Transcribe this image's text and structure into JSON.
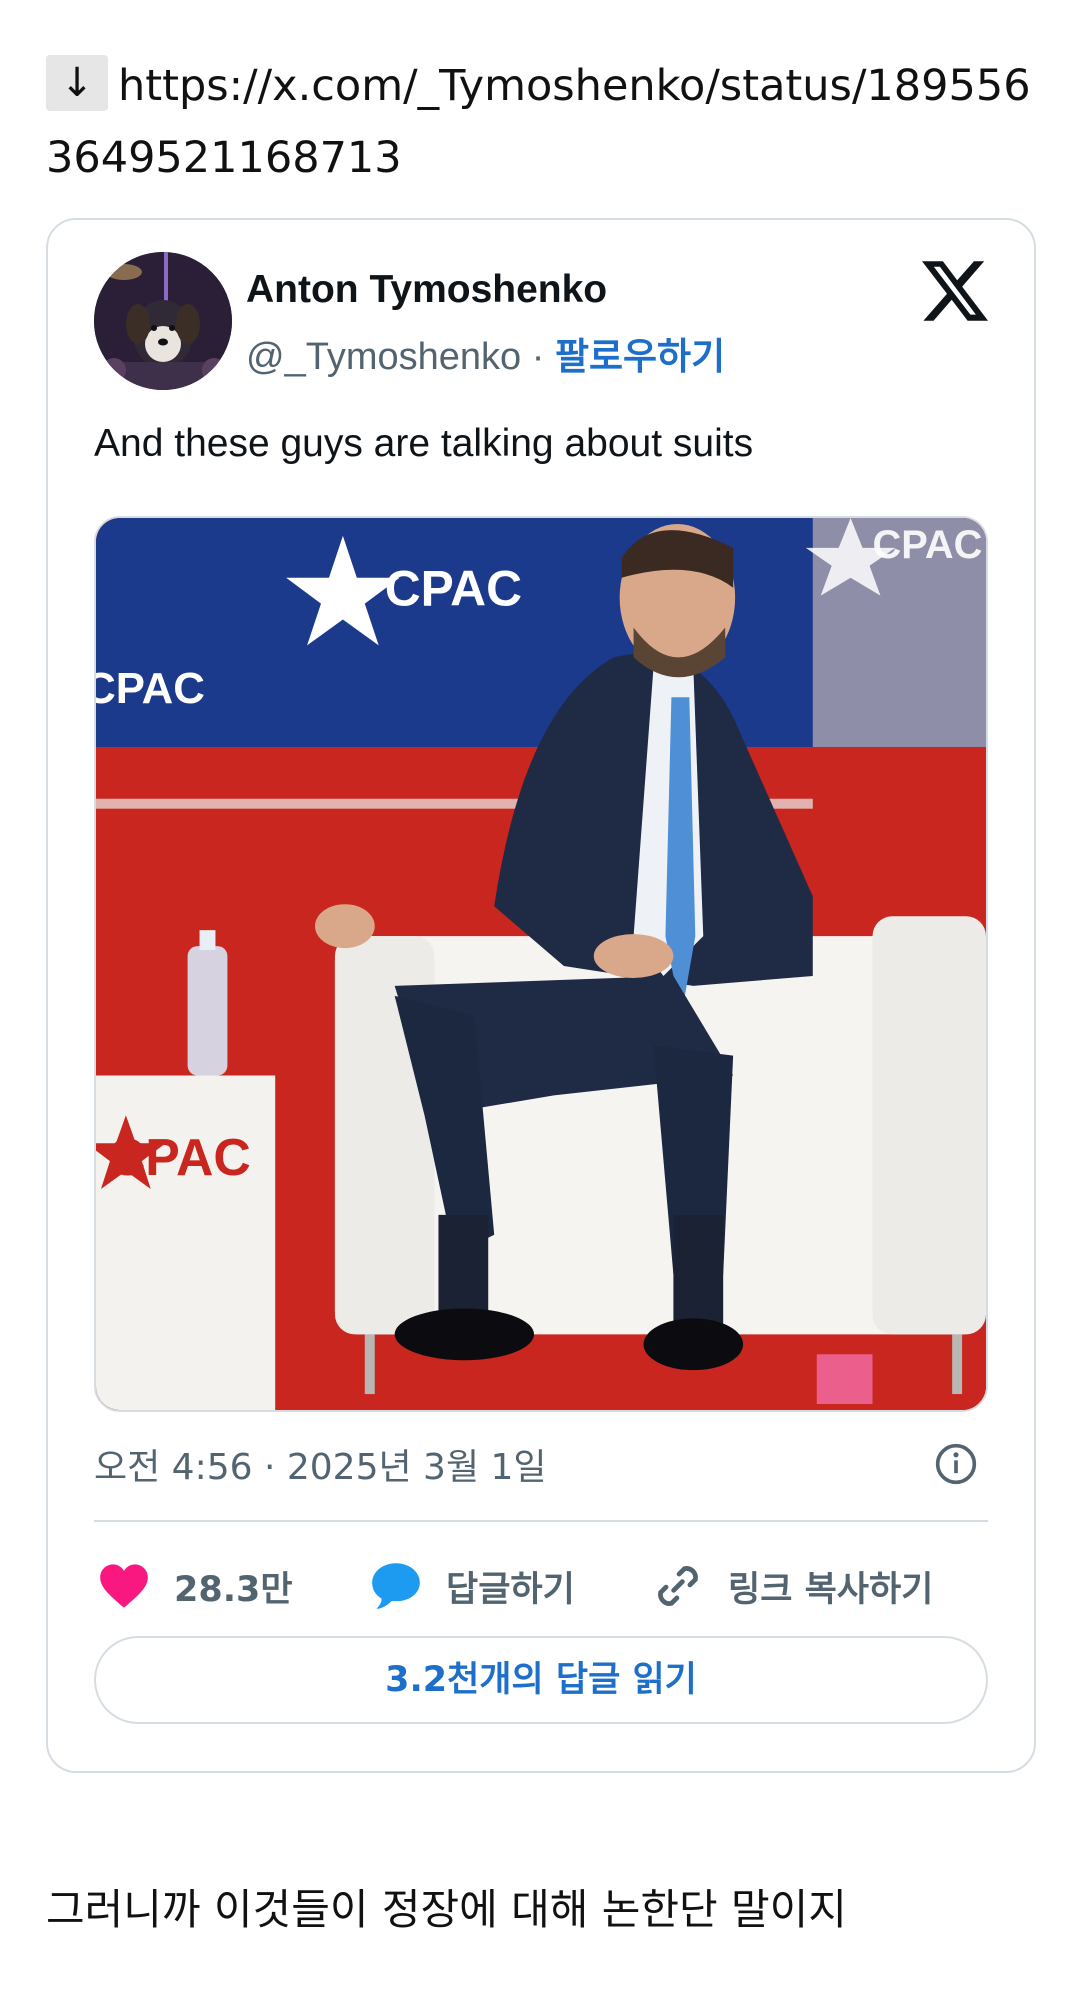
{
  "link": {
    "arrow": "↓",
    "url": "https://x.com/_Tymoshenko/status/1895563649521168713"
  },
  "tweet": {
    "author_name": "Anton Tymoshenko",
    "handle": "@_Tymoshenko",
    "separator": " · ",
    "follow_label": "팔로우하기",
    "text": "And these guys are talking about suits",
    "timestamp": "오전 4:56 · 2025년 3월 1일",
    "likes_count": "28.3만",
    "reply_label": "답글하기",
    "copy_link_label": "링크 복사하기",
    "read_replies_label": "3.2천개의 답글 읽기",
    "media_signage": {
      "logo_text_1": "CPAC",
      "logo_text_2": "CPAC",
      "logo_text_3": "CPAC",
      "logo_text_4": "CPAC"
    }
  },
  "caption": "그러니까 이것들이 정장에 대해 논한단 말이지",
  "colors": {
    "like": "#f91880",
    "reply": "#1d9bf0",
    "link": "#1d6fc9",
    "muted": "#536471",
    "stage_red": "#c8261e",
    "backdrop_blue": "#1b3a8c"
  },
  "icons": [
    "down-arrow-icon",
    "x-logo-icon",
    "info-icon",
    "heart-icon",
    "speech-bubble-icon",
    "link-icon"
  ]
}
